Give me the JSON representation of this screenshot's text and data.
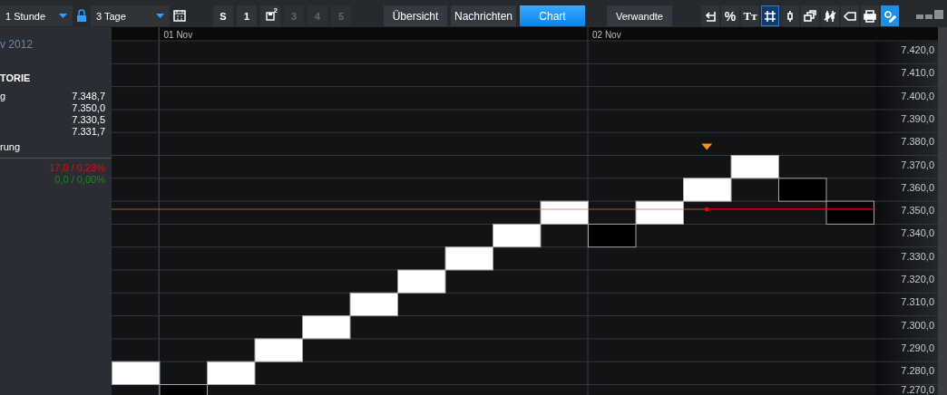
{
  "toolbar": {
    "interval": {
      "value": "1 Stunde"
    },
    "locked": true,
    "range": {
      "value": "3 Tage"
    },
    "slots": [
      {
        "label": "S",
        "kind": "text",
        "disabled": false
      },
      {
        "label": "1",
        "kind": "text",
        "disabled": false
      },
      {
        "label": "2",
        "kind": "save",
        "disabled": false
      },
      {
        "label": "3",
        "kind": "text",
        "disabled": true
      },
      {
        "label": "4",
        "kind": "text",
        "disabled": true
      },
      {
        "label": "5",
        "kind": "text",
        "disabled": true
      }
    ],
    "tabs": [
      {
        "label": "Übersicht",
        "selected": false
      },
      {
        "label": "Nachrichten",
        "selected": false
      },
      {
        "label": "Chart",
        "selected": true
      }
    ],
    "related": "Verwandte",
    "tools": [
      {
        "kind": "back",
        "selected": false
      },
      {
        "kind": "percent",
        "label": "%",
        "selected": false
      },
      {
        "kind": "text",
        "label": "Tт",
        "selected": false
      },
      {
        "kind": "grid",
        "selected": true
      },
      {
        "kind": "candle",
        "selected": false
      },
      {
        "kind": "layers",
        "selected": false
      },
      {
        "kind": "candles",
        "selected": false
      },
      {
        "kind": "tag",
        "selected": false
      },
      {
        "kind": "print",
        "selected": false
      },
      {
        "kind": "settings",
        "selected": true
      }
    ]
  },
  "sidebar": {
    "date": "v 2012",
    "heading": "TORIE",
    "rows": [
      {
        "label": "g",
        "value": "7.348,7"
      },
      {
        "value": "7.350,0"
      },
      {
        "value": "7.330,5"
      },
      {
        "value": "7.331,7"
      }
    ],
    "section": "rung",
    "changes": [
      {
        "text": "17,0 / 0,23%",
        "color": "#e01010"
      },
      {
        "text": "0,0 / 0,00%",
        "color": "#1a8a1a"
      }
    ]
  },
  "chart": {
    "price_labels": [
      "7.420,0",
      "7.410,0",
      "7.400,0",
      "7.390,0",
      "7.380,0",
      "7.370,0",
      "7.360,0",
      "7.350,0",
      "7.340,0",
      "7.330,0",
      "7.320,0",
      "7.310,0",
      "7.300,0",
      "7.290,0",
      "7.280,0",
      "7.270,0"
    ],
    "bricks": [
      {
        "rising": true,
        "marked": false
      },
      {
        "rising": false,
        "date": "01 Nov",
        "marked": false
      },
      {
        "rising": true,
        "marked": false
      },
      {
        "rising": true,
        "marked": false
      },
      {
        "rising": true,
        "marked": false
      },
      {
        "rising": true,
        "marked": false
      },
      {
        "rising": true,
        "marked": false
      },
      {
        "rising": true,
        "marked": false
      },
      {
        "rising": true,
        "marked": false
      },
      {
        "rising": true,
        "marked": false
      },
      {
        "rising": false,
        "date": "02 Nov",
        "marked": false
      },
      {
        "rising": true,
        "marked": false
      },
      {
        "rising": true,
        "marked": true
      },
      {
        "rising": true,
        "marked": false
      },
      {
        "rising": false,
        "marked": false
      },
      {
        "rising": false,
        "marked": false
      }
    ]
  }
}
